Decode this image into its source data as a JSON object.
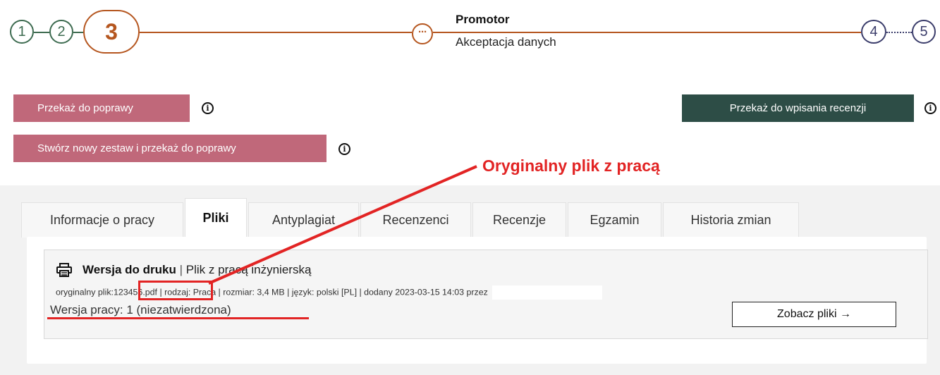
{
  "stepper": {
    "steps": [
      "1",
      "2",
      "3",
      "4",
      "5"
    ],
    "current_step_dots": "···",
    "stage_role": "Promotor",
    "stage_name": "Akceptacja danych"
  },
  "actions": {
    "return_for_fix": "Przekaż do poprawy",
    "new_set_return": "Stwórz nowy zestaw i przekaż do poprawy",
    "send_for_review": "Przekaż do wpisania recenzji",
    "info_glyph": "i"
  },
  "annotation": {
    "text": "Oryginalny plik z pracą"
  },
  "tabs": [
    {
      "label": "Informacje o pracy",
      "active": false
    },
    {
      "label": "Pliki",
      "active": true
    },
    {
      "label": "Antyplagiat",
      "active": false
    },
    {
      "label": "Recenzenci",
      "active": false
    },
    {
      "label": "Recenzje",
      "active": false
    },
    {
      "label": "Egzamin",
      "active": false
    },
    {
      "label": "Historia zmian",
      "active": false
    }
  ],
  "file": {
    "title": "Wersja do druku",
    "separator": "|",
    "subtitle": "Plik z pracą inżynierską",
    "meta_prefix": "oryginalny plik:",
    "filename": "123456.pdf",
    "meta_rest": "| rodzaj: Praca | rozmiar: 3,4 MB | język: polski [PL] | dodany 2023-03-15 14:03 przez",
    "version": "Wersja pracy: 1 (niezatwierdzona)",
    "see_files_label": "Zobacz pliki →"
  },
  "colors": {
    "done_green": "#3d6b50",
    "current_orange": "#b5561f",
    "future_navy": "#3b3d6b",
    "rose_button": "#c0687a",
    "dark_button": "#2d4d46",
    "annotation_red": "#e22424"
  },
  "icons": [
    "info-icon",
    "printer-icon",
    "arrow-right-icon"
  ]
}
